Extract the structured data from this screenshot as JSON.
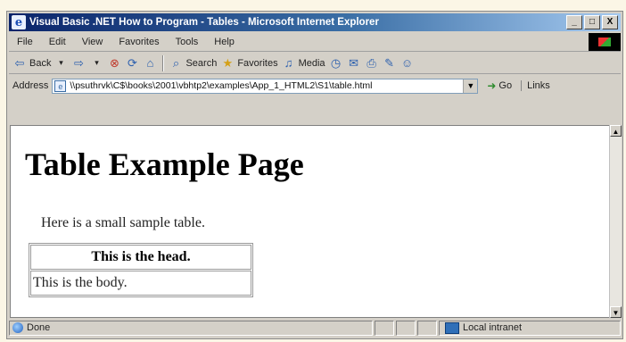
{
  "window": {
    "title": "Visual Basic .NET How to Program - Tables - Microsoft Internet Explorer",
    "app_icon": "ie-page-icon",
    "controls": {
      "minimize": "_",
      "maximize": "□",
      "close": "X"
    }
  },
  "menu": [
    "File",
    "Edit",
    "View",
    "Favorites",
    "Tools",
    "Help"
  ],
  "toolbar": {
    "back": "Back",
    "search": "Search",
    "favorites": "Favorites",
    "media": "Media"
  },
  "address": {
    "label": "Address",
    "url": "\\\\psuthrvk\\C$\\books\\2001\\vbhtp2\\examples\\App_1_HTML2\\S1\\table.html",
    "go": "Go",
    "links": "Links"
  },
  "page": {
    "heading": "Table Example Page",
    "intro": "Here is a small sample table.",
    "table": {
      "head": "This is the head.",
      "body": "This is the body."
    }
  },
  "status": {
    "text": "Done",
    "zone": "Local intranet"
  },
  "colors": {
    "titlebar_start": "#0a246a",
    "titlebar_end": "#a6caf0",
    "chrome": "#d4d0c8",
    "page_bg": "#ffffff"
  }
}
